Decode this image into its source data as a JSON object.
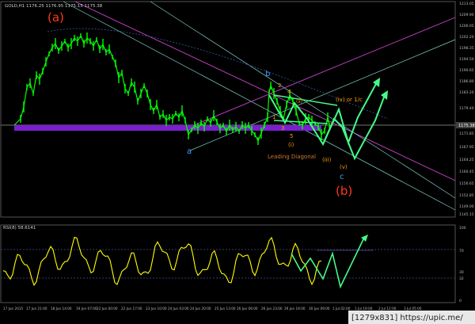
{
  "chart_window": {
    "main_header": "GOLD,H1  1176.25 1176.95 1175.15 1175.38",
    "rsi_header": "RSI(8) 58.6141",
    "watermark": "[1279x831] https://upic.me/"
  },
  "price_axis": {
    "labels": [
      "1213.05",
      "1209.90",
      "1206.05",
      "1202.20",
      "1198.35",
      "1194.50",
      "1190.65",
      "1186.80",
      "1183.20",
      "1179.40",
      "1175.38",
      "1171.85",
      "1167.95",
      "1164.25",
      "1160.45",
      "1156.65",
      "1152.85",
      "1149.00",
      "1145.15"
    ],
    "current_price": "1175.38",
    "current_price_color": "#404040"
  },
  "rsi_axis": {
    "labels": [
      "100",
      "70",
      "30",
      "32",
      "0"
    ]
  },
  "time_axis": {
    "labels": [
      "17 Jun 2015",
      "17 Jun 21:00",
      "18 Jun 14:00",
      "19 Jun 07:00",
      "22 Jun 00:00",
      "22 Jun 17:00",
      "23 Jun 10:00",
      "24 Jun 03:00",
      "24 Jun 20:00",
      "25 Jun 13:00",
      "26 Jun 06:00",
      "26 Jun 23:00",
      "29 Jun 16:00",
      "30 Jun 09:00",
      "1 Jul 02:00",
      "1 Jul 19:00",
      "2 Jul 12:00",
      "3 Jul 05:00"
    ]
  },
  "annotations": {
    "wave_a_big": "(a)",
    "wave_b_big": "(b)",
    "wave_a": "a",
    "wave_b": "b",
    "wave_c": "c",
    "n1": "1",
    "n2": "2",
    "n3": "3",
    "n4": "4",
    "n5": "5",
    "wi": "(i)",
    "wii": "(ii)",
    "wiii": "(iii)",
    "wiv": "(iv) or 1/c",
    "wv": "(v)",
    "leading_diagonal": "Leading Diagonal"
  },
  "colors": {
    "background": "#000000",
    "candles": "#00ff00",
    "projection": "#44ff88",
    "support_band": "#7a1fd0",
    "rsi_line": "#ffff00",
    "upper_channel": "#cc44cc",
    "lower_channel": "#7fd0c8",
    "wave_big": "#ff3a1a",
    "wave_minor": "#3aa0ff",
    "wave_count": "#ff9a00"
  }
}
